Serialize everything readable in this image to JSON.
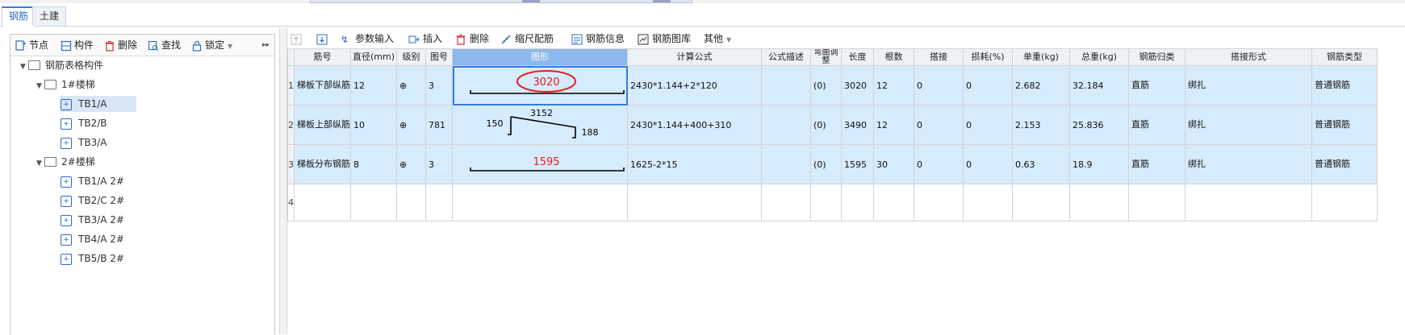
{
  "tabs": [
    {
      "label": "钢筋"
    },
    {
      "label": "土建"
    }
  ],
  "left_toolbar": {
    "node": "节点",
    "component": "构件",
    "delete": "删除",
    "find": "查找",
    "lock": "锁定",
    "more": "▸▸"
  },
  "tree": {
    "root": "钢筋表格构件",
    "groups": [
      {
        "label": "1#楼梯",
        "items": [
          "TB1/A",
          "TB2/B",
          "TB3/A"
        ]
      },
      {
        "label": "2#楼梯",
        "items": [
          "TB1/A 2#",
          "TB2/C 2#",
          "TB3/A 2#",
          "TB4/A 2#",
          "TB5/B 2#"
        ]
      }
    ]
  },
  "right_toolbar": {
    "param_input": "参数输入",
    "insert": "插入",
    "delete": "删除",
    "scale_rebar": "缩尺配筋",
    "rebar_info": "钢筋信息",
    "rebar_library": "钢筋图库",
    "other": "其他"
  },
  "table": {
    "headers": [
      "筋号",
      "直径(mm)",
      "级别",
      "图号",
      "图形",
      "计算公式",
      "公式描述",
      "弯曲调整",
      "长度",
      "根数",
      "搭接",
      "损耗(%)",
      "单重(kg)",
      "总重(kg)",
      "钢筋归类",
      "搭接形式",
      "钢筋类型"
    ],
    "rows": [
      {
        "num": "1",
        "name": "梯板下部纵筋",
        "diameter": "12",
        "grade": "⊕",
        "fig_no": "3",
        "fig_value": "3020",
        "formula": "2430*1.144+2*120",
        "desc": "",
        "bend": "(0)",
        "length": "3020",
        "count": "12",
        "lap": "0",
        "loss": "0",
        "unit_weight": "2.682",
        "total_weight": "32.184",
        "category": "直筋",
        "lap_type": "绑扎",
        "rebar_type": "普通钢筋"
      },
      {
        "num": "2",
        "name": "梯板上部纵筋",
        "diameter": "10",
        "grade": "⊕",
        "fig_no": "781",
        "fig_top": "3152",
        "fig_left": "150",
        "fig_right": "188",
        "formula": "2430*1.144+400+310",
        "desc": "",
        "bend": "(0)",
        "length": "3490",
        "count": "12",
        "lap": "0",
        "loss": "0",
        "unit_weight": "2.153",
        "total_weight": "25.836",
        "category": "直筋",
        "lap_type": "绑扎",
        "rebar_type": "普通钢筋"
      },
      {
        "num": "3",
        "name": "梯板分布钢筋",
        "diameter": "8",
        "grade": "⊕",
        "fig_no": "3",
        "fig_value": "1595",
        "formula": "1625-2*15",
        "desc": "",
        "bend": "(0)",
        "length": "1595",
        "count": "30",
        "lap": "0",
        "loss": "0",
        "unit_weight": "0.63",
        "total_weight": "18.9",
        "category": "直筋",
        "lap_type": "绑扎",
        "rebar_type": "普通钢筋"
      },
      {
        "num": "4"
      }
    ]
  },
  "colors": {
    "row_fill": "#d6ebfb",
    "selected_header": "#8cb8ec",
    "accent": "#2b6cc4",
    "annotation_red": "#e02020"
  }
}
